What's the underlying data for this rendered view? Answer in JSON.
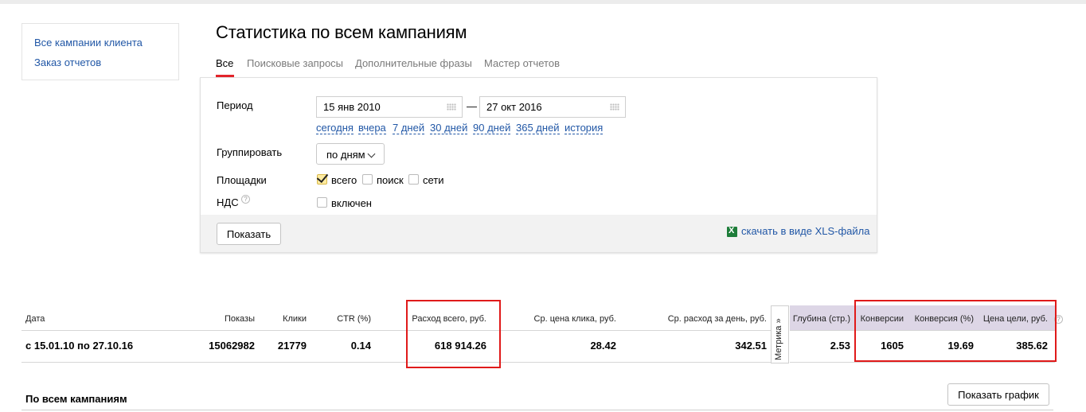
{
  "sidebar": {
    "links": [
      "Все кампании клиента",
      "Заказ отчетов"
    ]
  },
  "page_title": "Статистика по всем кампаниям",
  "tabs": [
    "Все",
    "Поисковые запросы",
    "Дополнительные фразы",
    "Мастер отчетов"
  ],
  "active_tab": "Все",
  "form": {
    "period_label": "Период",
    "date_from": "15 янв 2010",
    "date_separator": "—",
    "date_to": "27 окт 2016",
    "quick_ranges": [
      "сегодня",
      "вчера",
      "7 дней",
      "30 дней",
      "90 дней",
      "365 дней",
      "история"
    ],
    "group_label": "Группировать",
    "group_value": "по дням",
    "platforms_label": "Площадки",
    "platforms": [
      {
        "label": "всего",
        "checked": true
      },
      {
        "label": "поиск",
        "checked": false
      },
      {
        "label": "сети",
        "checked": false
      }
    ],
    "vat_label": "НДС",
    "vat_help": "?",
    "vat_option": "включен",
    "vat_checked": false,
    "show_button": "Показать",
    "xls_link": "скачать в виде XLS-файла",
    "xls_icon": "excel-icon"
  },
  "stats_table": {
    "columns": [
      "Дата",
      "Показы",
      "Клики",
      "CTR (%)",
      "Расход всего, руб.",
      "Ср. цена клика, руб.",
      "Ср. расход за день, руб.",
      "Метрика »",
      "Глубина (стр.)",
      "Конверсии",
      "Конверсия (%)",
      "Цена цели, руб."
    ],
    "row": {
      "date": "с 15.01.10 по 27.10.16",
      "impressions": "15062982",
      "clicks": "21779",
      "ctr": "0.14",
      "spend_total": "618 914.26",
      "avg_cpc": "28.42",
      "avg_daily_spend": "342.51",
      "depth": "2.53",
      "conversions": "1605",
      "conversion_rate": "19.69",
      "goal_cost": "385.62"
    },
    "help": "?"
  },
  "footer": {
    "section_title": "По всем кампаниям",
    "chart_button": "Показать график"
  },
  "colors": {
    "link": "#2157a6",
    "accent_red": "#e01a1a",
    "tab_underline": "#e3242b",
    "metrika_header": "#ddd6e6"
  }
}
